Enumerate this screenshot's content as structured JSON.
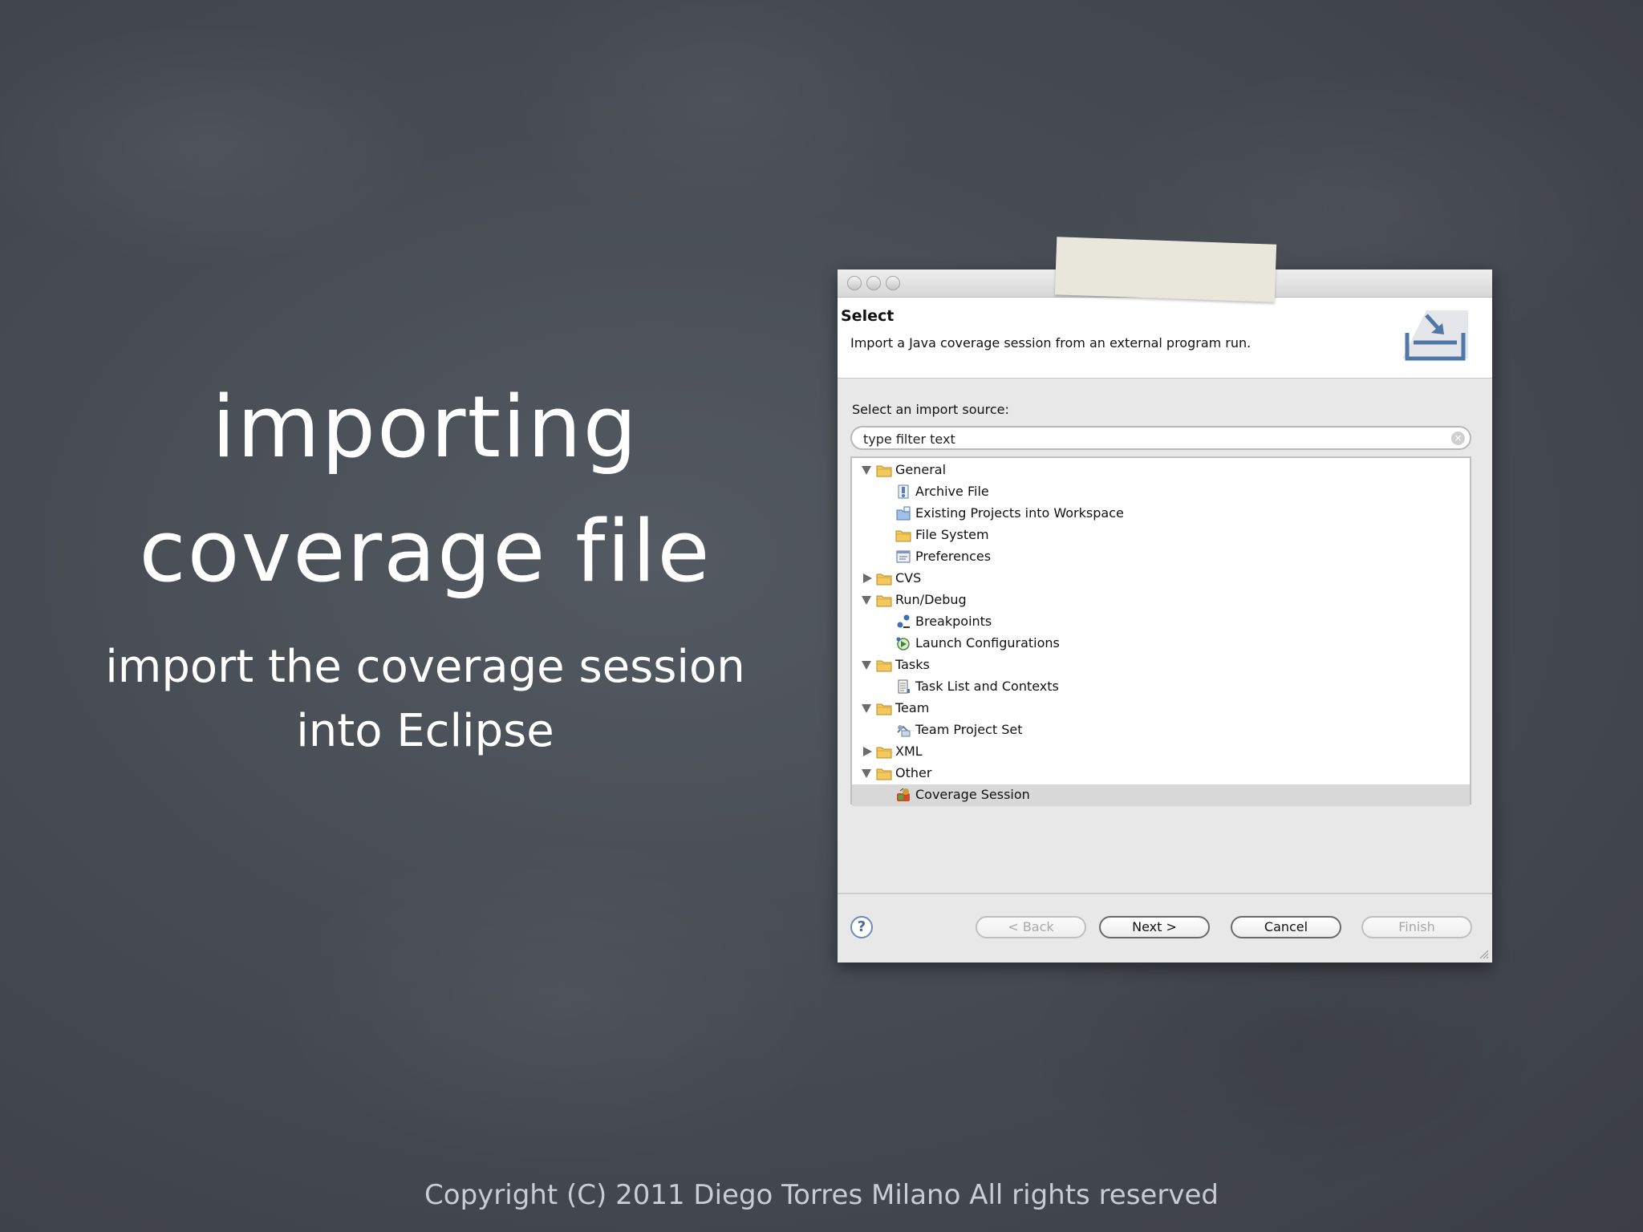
{
  "slide": {
    "title_line1": "importing",
    "title_line2": "coverage file",
    "subtitle_line1": "import the coverage session",
    "subtitle_line2": "into Eclipse",
    "copyright": "Copyright (C) 2011  Diego Torres Milano  All rights reserved"
  },
  "dialog": {
    "header_title": "Select",
    "header_description": "Import a Java coverage session from an external program run.",
    "source_label": "Select an import source:",
    "filter_value": "type filter text",
    "tree": [
      {
        "label": "General",
        "level": 0,
        "expanded": true,
        "icon": "folder-icon"
      },
      {
        "label": "Archive File",
        "level": 1,
        "icon": "archive-file-icon"
      },
      {
        "label": "Existing Projects into Workspace",
        "level": 1,
        "icon": "projects-icon"
      },
      {
        "label": "File System",
        "level": 1,
        "icon": "folder-icon"
      },
      {
        "label": "Preferences",
        "level": 1,
        "icon": "preferences-icon"
      },
      {
        "label": "CVS",
        "level": 0,
        "expanded": false,
        "icon": "folder-icon"
      },
      {
        "label": "Run/Debug",
        "level": 0,
        "expanded": true,
        "icon": "folder-icon"
      },
      {
        "label": "Breakpoints",
        "level": 1,
        "icon": "breakpoints-icon"
      },
      {
        "label": "Launch Configurations",
        "level": 1,
        "icon": "launch-config-icon"
      },
      {
        "label": "Tasks",
        "level": 0,
        "expanded": true,
        "icon": "folder-icon"
      },
      {
        "label": "Task List and Contexts",
        "level": 1,
        "icon": "task-list-icon"
      },
      {
        "label": "Team",
        "level": 0,
        "expanded": true,
        "icon": "folder-icon"
      },
      {
        "label": "Team Project Set",
        "level": 1,
        "icon": "team-project-icon"
      },
      {
        "label": "XML",
        "level": 0,
        "expanded": false,
        "icon": "folder-icon"
      },
      {
        "label": "Other",
        "level": 0,
        "expanded": true,
        "icon": "folder-icon"
      },
      {
        "label": "Coverage Session",
        "level": 1,
        "icon": "coverage-session-icon",
        "selected": true
      }
    ],
    "help_label": "?",
    "buttons": {
      "back": "< Back",
      "next": "Next >",
      "cancel": "Cancel",
      "finish": "Finish"
    }
  },
  "colors": {
    "background": "#474c53",
    "dialog_bg": "#e8e8e8",
    "selection": "#d8d8d8"
  }
}
